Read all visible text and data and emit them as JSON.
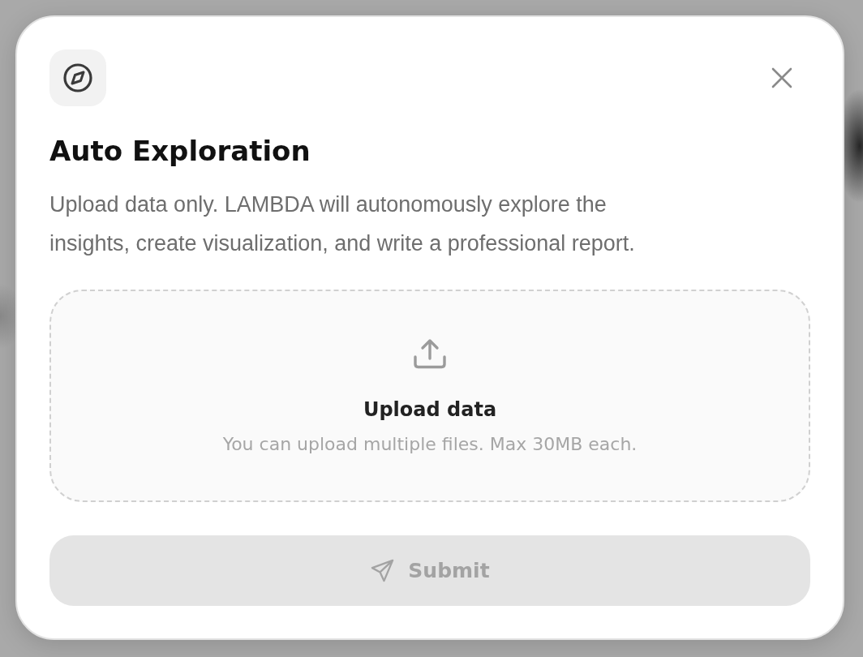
{
  "dialog": {
    "title": "Auto Exploration",
    "description": "Upload data only. LAMBDA will autonomously explore the insights, create visualization, and write a professional report."
  },
  "upload": {
    "title": "Upload data",
    "hint": "You can upload multiple files. Max 30MB each."
  },
  "submit": {
    "label": "Submit",
    "disabled": true
  }
}
